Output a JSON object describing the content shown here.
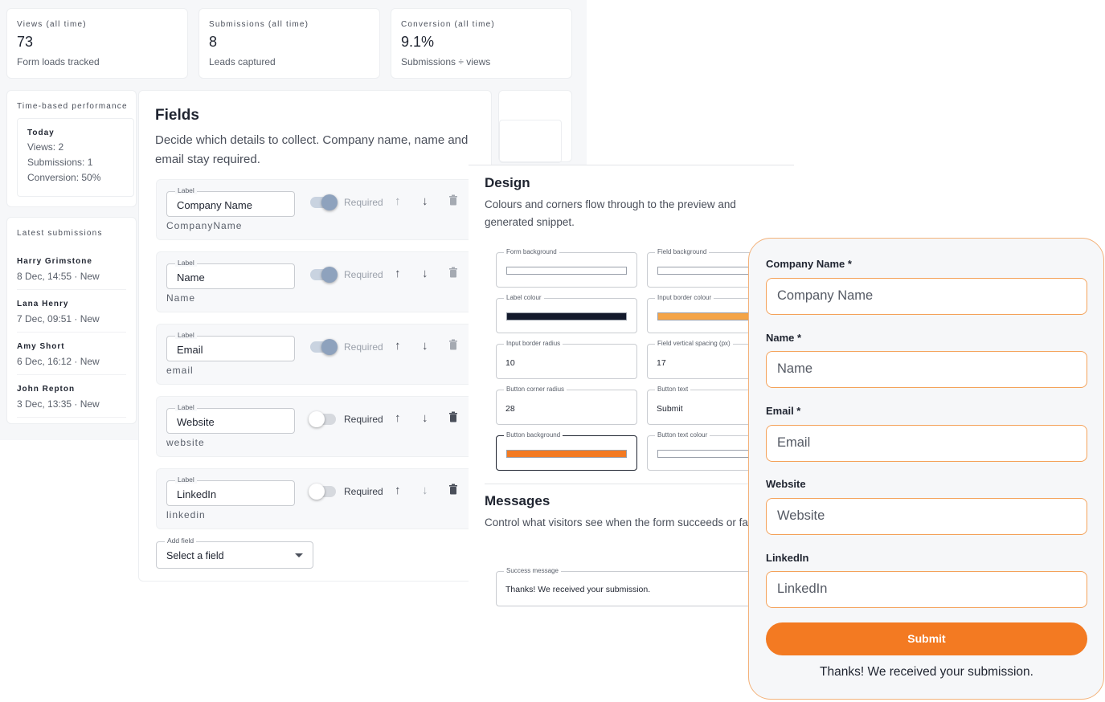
{
  "stats": [
    {
      "title": "Views (all time)",
      "value": "73",
      "sub": "Form loads tracked"
    },
    {
      "title": "Submissions (all time)",
      "value": "8",
      "sub": "Leads captured"
    },
    {
      "title": "Conversion (all time)",
      "value": "9.1%",
      "sub": "Submissions ÷ views"
    }
  ],
  "performance": {
    "title": "Time-based performance",
    "period": "Today",
    "views": "Views: 2",
    "submissions": "Submissions: 1",
    "conversion": "Conversion: 50%"
  },
  "latest": {
    "title": "Latest submissions",
    "items": [
      {
        "name": "Harry Grimstone",
        "meta": "8 Dec, 14:55 · New"
      },
      {
        "name": "Lana Henry",
        "meta": "7 Dec, 09:51 · New"
      },
      {
        "name": "Amy Short",
        "meta": "6 Dec, 16:12 · New"
      },
      {
        "name": "John Repton",
        "meta": "3 Dec, 13:35 · New"
      }
    ]
  },
  "fields": {
    "title": "Fields",
    "description": "Decide which details to collect. Company name, name and email stay required.",
    "label_tag": "Label",
    "required_text": "Required",
    "rows": [
      {
        "label": "Company Name",
        "key": "CompanyName",
        "required": true,
        "locked": true
      },
      {
        "label": "Name",
        "key": "Name",
        "required": true,
        "locked": true
      },
      {
        "label": "Email",
        "key": "email",
        "required": true,
        "locked": true
      },
      {
        "label": "Website",
        "key": "website",
        "required": false,
        "locked": false
      },
      {
        "label": "LinkedIn",
        "key": "linkedin",
        "required": false,
        "locked": false
      }
    ],
    "add_field": {
      "tag": "Add field",
      "value": "Select a field"
    }
  },
  "design": {
    "title": "Design",
    "description": "Colours and corners flow through to the preview and generated snippet.",
    "form_background": {
      "tag": "Form background",
      "color": "#ffffff"
    },
    "field_background": {
      "tag": "Field background",
      "color": "#ffffff"
    },
    "label_colour": {
      "tag": "Label colour",
      "color": "#131a2c"
    },
    "input_border_colour": {
      "tag": "Input border colour",
      "color": "#f4a447"
    },
    "input_border_radius": {
      "tag": "Input border radius",
      "value": "10"
    },
    "field_vertical_spacing": {
      "tag": "Field vertical spacing (px)",
      "value": "17"
    },
    "button_corner_radius": {
      "tag": "Button corner radius",
      "value": "28"
    },
    "button_text": {
      "tag": "Button text",
      "value": "Submit"
    },
    "button_background": {
      "tag": "Button background",
      "color": "#f37a22"
    },
    "button_text_colour": {
      "tag": "Button text colour",
      "color": "#ffffff"
    }
  },
  "messages": {
    "title": "Messages",
    "description": "Control what visitors see when the form succeeds or fails.",
    "success": {
      "tag": "Success message",
      "value": "Thanks! We received your submission."
    }
  },
  "preview": {
    "fields": [
      {
        "label": "Company Name *",
        "placeholder": "Company Name"
      },
      {
        "label": "Name *",
        "placeholder": "Name"
      },
      {
        "label": "Email *",
        "placeholder": "Email"
      },
      {
        "label": "Website",
        "placeholder": "Website"
      },
      {
        "label": "LinkedIn",
        "placeholder": "LinkedIn"
      }
    ],
    "submit": "Submit",
    "thanks": "Thanks! We received your submission.",
    "accent": "#f37a22"
  }
}
